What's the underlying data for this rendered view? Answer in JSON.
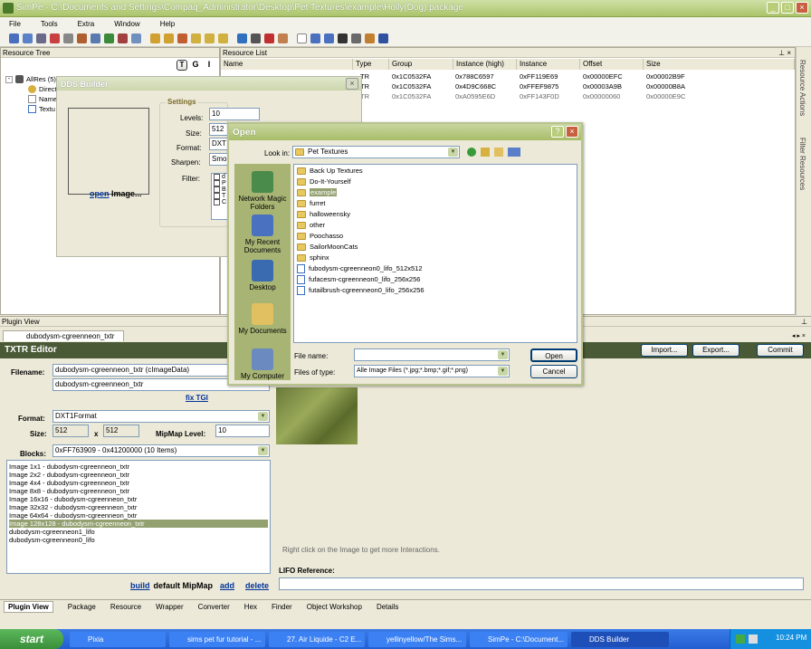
{
  "window": {
    "title": "SimPe - C:\\Documents and Settings\\Compaq_Administrator\\Desktop\\Pet Textures\\example\\Holly(Dog).package"
  },
  "menu": [
    "File",
    "Tools",
    "Extra",
    "Window",
    "Help"
  ],
  "resource_tree": {
    "title": "Resource Tree",
    "root": "AllRes (5)",
    "items": [
      "Direct",
      "Name",
      "Textu"
    ],
    "buttons": [
      "T",
      "G",
      "I"
    ]
  },
  "resource_list": {
    "title": "Resource List",
    "columns": [
      "Name",
      "Type",
      "Group",
      "Instance (high)",
      "Instance",
      "Offset",
      "Size"
    ],
    "rows": [
      [
        "",
        "TR",
        "0x1C0532FA",
        "0x788C6597",
        "0xFF119E69",
        "0x00000EFC",
        "0x00002B9F"
      ],
      [
        "",
        "TR",
        "0x1C0532FA",
        "0x4D9C668C",
        "0xFFEF9875",
        "0x00003A9B",
        "0x00000B8A"
      ],
      [
        "",
        "TR",
        "0x1C0532FA",
        "0xA0595E6D",
        "0xFF143F0D",
        "0x00000060",
        "0x00000E9C"
      ]
    ]
  },
  "side_tabs": [
    "Resource Actions",
    "Filter Resources"
  ],
  "dds": {
    "title": "DDS Builder",
    "settings_label": "Settings",
    "levels_label": "Levels:",
    "levels": "10",
    "size_label": "Size:",
    "size": "512",
    "format_label": "Format:",
    "format": "DXT",
    "sharpen_label": "Sharpen:",
    "sharpen": "Smo",
    "filter_label": "Filter:",
    "filter_items": [
      "d",
      "P",
      "B",
      "T",
      "C"
    ],
    "open_link": "open",
    "open_suffix": "Image..."
  },
  "plugin": {
    "title": "Plugin View",
    "tab": "dubodysm-cgreenneon_txtr",
    "editor_title": "TXTR Editor",
    "import": "Import...",
    "export": "Export...",
    "commit": "Commit",
    "filename_label": "Filename:",
    "filename": "dubodysm-cgreenneon_txtr (cImageData)",
    "filename2": "dubodysm-cgreenneon_txtr",
    "fix_tgi": "fix TGI",
    "format_label": "Format:",
    "format": "DXT1Format",
    "size_label": "Size:",
    "width": "512",
    "x": "x",
    "height": "512",
    "mipmap_label": "MipMap Level:",
    "mipmap": "10",
    "blocks_label": "Blocks:",
    "blocks": "0xFF763909 - 0x41200000 (10 Items)",
    "block_items": [
      "Image 1x1 - dubodysm-cgreenneon_txtr",
      "Image 2x2 - dubodysm-cgreenneon_txtr",
      "Image 4x4 - dubodysm-cgreenneon_txtr",
      "Image 8x8 - dubodysm-cgreenneon_txtr",
      "Image 16x16 - dubodysm-cgreenneon_txtr",
      "Image 32x32 - dubodysm-cgreenneon_txtr",
      "Image 64x64 - dubodysm-cgreenneon_txtr",
      "Image 128x128 - dubodysm-cgreenneon_txtr",
      "dubodysm-cgreenneon1_lifo",
      "dubodysm-cgreenneon0_lifo"
    ],
    "selected_index": 7,
    "build": "build",
    "default_mipmap": "default MipMap",
    "add": "add",
    "delete": "delete",
    "hint": "Right click on the Image to get more Interactions.",
    "lifo_label": "LIFO Reference:"
  },
  "bottom_tabs": [
    "Plugin View",
    "Package",
    "Resource",
    "Wrapper",
    "Converter",
    "Hex",
    "Finder",
    "Object Workshop",
    "Details"
  ],
  "open_dialog": {
    "title": "Open",
    "look_in_label": "Look in:",
    "look_in": "Pet Textures",
    "places": [
      "Network Magic Folders",
      "My Recent Documents",
      "Desktop",
      "My Documents",
      "My Computer"
    ],
    "folders": [
      "Back Up Textures",
      "Do-It-Yourself",
      "example",
      "furret",
      "halloweensky",
      "other",
      "Poochasso",
      "SailorMoonCats",
      "sphinx"
    ],
    "files": [
      "fubodysm-cgreenneon0_lifo_512x512",
      "fufacesm-cgreenneon0_lifo_256x256",
      "futailbrush-cgreenneon0_lifo_256x256"
    ],
    "selected_folder": "example",
    "filename_label": "File name:",
    "filetype_label": "Files of type:",
    "filetype": "Alle Image Files (*.jpg;*.bmp;*.gif;*.png)",
    "open_btn": "Open",
    "cancel_btn": "Cancel"
  },
  "taskbar": {
    "start": "start",
    "items": [
      "Pixia",
      "sims pet fur tutorial - ...",
      "27. Air Liquide - C2 E...",
      "yellinyellow/The Sims...",
      "SimPe - C:\\Document...",
      "DDS Builder"
    ],
    "time": "10:24 PM"
  }
}
